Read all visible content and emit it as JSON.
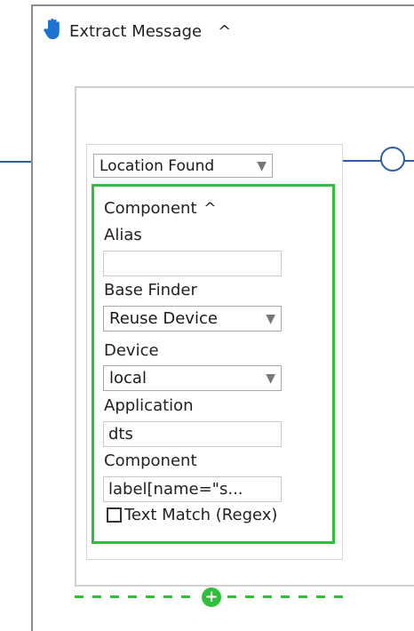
{
  "step": {
    "title": "Extract Message",
    "collapse_icon": "chevron-up-icon",
    "hand_icon": "hand-icon"
  },
  "condition": {
    "selected": "Location Found",
    "caret": "▼"
  },
  "component": {
    "heading": "Component",
    "collapse": "^",
    "alias_label": "Alias",
    "alias_value": "",
    "base_finder_label": "Base Finder",
    "base_finder_value": "Reuse Device",
    "device_label": "Device",
    "device_value": "local",
    "application_label": "Application",
    "application_value": "dts",
    "component_label": "Component",
    "component_value": "label[name=\"s...",
    "text_match_label": "Text Match (Regex)",
    "text_match_checked": false
  },
  "colors": {
    "connector": "#2f5fa3",
    "highlight_green": "#2fbf3a",
    "hand_icon_blue": "#1e73d2"
  }
}
